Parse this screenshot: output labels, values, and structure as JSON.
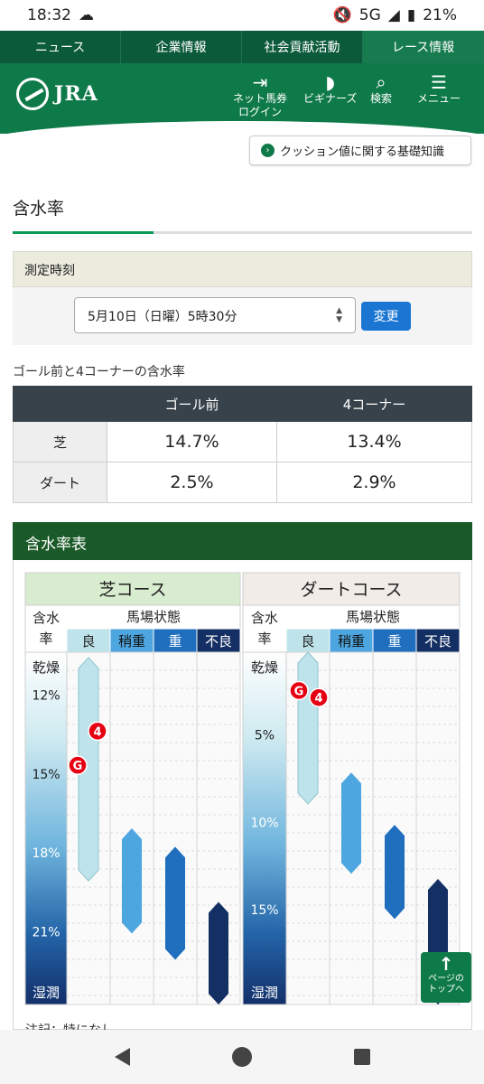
{
  "status": {
    "time": "18:32",
    "network": "5G",
    "battery": "21%"
  },
  "top_nav": [
    "ニュース",
    "企業情報",
    "社会貢献活動",
    "レース情報"
  ],
  "header": {
    "logo_text": "JRA",
    "login_label": [
      "ネット馬券",
      "ログイン"
    ],
    "beginners_label": "ビギナーズ",
    "search_label": "検索",
    "menu_label": "メニュー"
  },
  "cushion_link": "クッション値に関する基礎知識",
  "page_title": "含水率",
  "measure": {
    "heading": "測定時刻",
    "selected": "5月10日（日曜）5時30分",
    "change_button": "変更"
  },
  "moisture_table": {
    "caption": "ゴール前と4コーナーの含水率",
    "headers": [
      "ゴール前",
      "4コーナー"
    ],
    "rows": [
      {
        "label": "芝",
        "goal": "14.7%",
        "corner4": "13.4%"
      },
      {
        "label": "ダート",
        "goal": "2.5%",
        "corner4": "2.9%"
      }
    ]
  },
  "chart_section_title": "含水率表",
  "chart_data": {
    "type": "table",
    "panels": [
      {
        "title": "芝コース",
        "col_head_left": [
          "含水",
          "率"
        ],
        "col_head_right": "馬場状態",
        "conditions": [
          "良",
          "稍重",
          "重",
          "不良"
        ],
        "axis_top": "乾燥",
        "axis_bottom": "湿潤",
        "ticks": [
          "12%",
          "15%",
          "18%",
          "21%"
        ],
        "tick_values": [
          12,
          15,
          18,
          21
        ],
        "range": [
          10.4,
          23.8
        ],
        "bands": [
          [
            10.6,
            19.1
          ],
          [
            17.1,
            21.1
          ],
          [
            17.8,
            22.1
          ],
          [
            19.9,
            23.8
          ]
        ],
        "markers": [
          {
            "label": "4",
            "value": 13.4
          },
          {
            "label": "G",
            "value": 14.7
          }
        ]
      },
      {
        "title": "ダートコース",
        "col_head_left": [
          "含水",
          "率"
        ],
        "col_head_right": "馬場状態",
        "conditions": [
          "良",
          "稍重",
          "重",
          "不良"
        ],
        "axis_top": "乾燥",
        "axis_bottom": "湿潤",
        "ticks": [
          "5%",
          "10%",
          "15%"
        ],
        "tick_values": [
          5,
          10,
          15
        ],
        "range": [
          0.3,
          20.5
        ],
        "bands": [
          [
            0.3,
            9.0
          ],
          [
            7.2,
            13.0
          ],
          [
            10.2,
            15.6
          ],
          [
            13.3,
            20.5
          ]
        ],
        "markers": [
          {
            "label": "G",
            "value": 2.5
          },
          {
            "label": "4",
            "value": 2.9
          }
        ]
      }
    ],
    "colors": {
      "良": "#bfe3ea",
      "稍重": "#4ea6e0",
      "重": "#1f6fbe",
      "不良": "#142f63",
      "shiba_head": "#d8eccf",
      "dirt_head": "#f1ece7",
      "marker": "#e60012"
    }
  },
  "footnote": "注記：特になし",
  "page_top": [
    "ページの",
    "トップへ"
  ]
}
